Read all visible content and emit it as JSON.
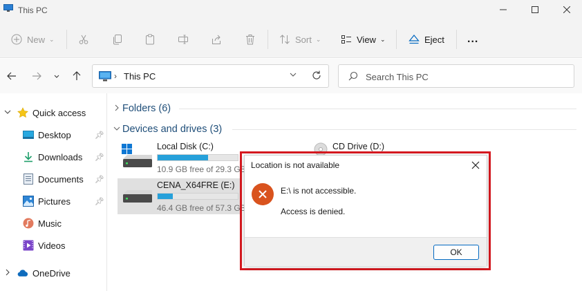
{
  "window": {
    "title": "This PC"
  },
  "toolbar": {
    "new_label": "New",
    "sort_label": "Sort",
    "view_label": "View",
    "eject_label": "Eject",
    "more_label": "..."
  },
  "address": {
    "path": "This PC"
  },
  "search": {
    "placeholder": "Search This PC"
  },
  "sidebar": {
    "items": [
      {
        "label": "Quick access",
        "icon": "star-icon"
      },
      {
        "label": "Desktop",
        "icon": "desktop-icon",
        "pinned": true
      },
      {
        "label": "Downloads",
        "icon": "download-icon",
        "pinned": true
      },
      {
        "label": "Documents",
        "icon": "documents-icon",
        "pinned": true
      },
      {
        "label": "Pictures",
        "icon": "pictures-icon",
        "pinned": true
      },
      {
        "label": "Music",
        "icon": "music-icon"
      },
      {
        "label": "Videos",
        "icon": "videos-icon"
      },
      {
        "label": "OneDrive",
        "icon": "cloud-icon"
      }
    ]
  },
  "groups": {
    "folders": "Folders (6)",
    "devices": "Devices and drives (3)"
  },
  "drives": [
    {
      "name": "Local Disk (C:)",
      "free": "10.9 GB free of 29.3 GB",
      "used_fraction": 0.63
    },
    {
      "name": "CENA_X64FRE (E:)",
      "free": "46.4 GB free of 57.3 GB",
      "used_fraction": 0.19
    },
    {
      "name": "CD Drive (D:)"
    }
  ],
  "dialog": {
    "title": "Location is not available",
    "message": "E:\\ is not accessible.",
    "detail": "Access is denied.",
    "ok_label": "OK"
  },
  "colors": {
    "accent": "#0067c0",
    "drive_bar": "#26a0da",
    "error": "#d9531e",
    "highlight": "#d71920"
  }
}
